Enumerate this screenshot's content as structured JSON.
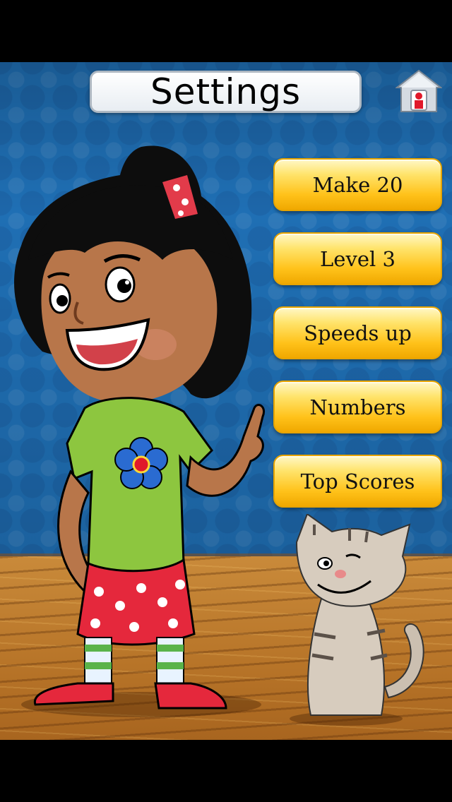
{
  "header": {
    "title": "Settings",
    "home_icon": "home-icon"
  },
  "menu": {
    "items": [
      {
        "label": "Make 20"
      },
      {
        "label": "Level 3"
      },
      {
        "label": "Speeds up"
      },
      {
        "label": "Numbers"
      },
      {
        "label": "Top Scores"
      }
    ]
  },
  "colors": {
    "wall": "#1f6fb4",
    "button_yellow": "#ffc21a",
    "floor": "#b77428"
  }
}
